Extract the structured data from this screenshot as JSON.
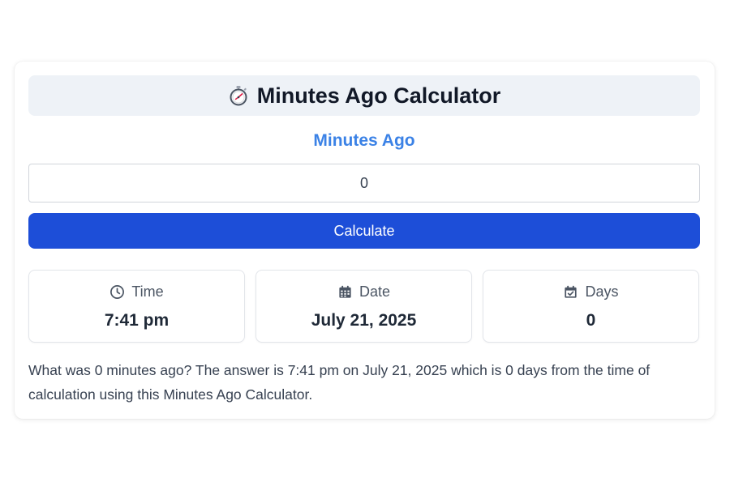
{
  "calculator": {
    "title": "Minutes Ago Calculator",
    "title_icon": "stopwatch-icon",
    "input_label": "Minutes Ago",
    "input_value": "0",
    "button_label": "Calculate"
  },
  "results": {
    "time": {
      "icon": "clock-icon",
      "label": "Time",
      "value": "7:41 pm"
    },
    "date": {
      "icon": "calendar-icon",
      "label": "Date",
      "value": "July 21, 2025"
    },
    "days": {
      "icon": "calendar-check-icon",
      "label": "Days",
      "value": "0"
    }
  },
  "description": "What was 0 minutes ago? The answer is 7:41 pm on July 21, 2025 which is 0 days from the time of calculation using this Minutes Ago Calculator.",
  "colors": {
    "accent_blue": "#3b82e6",
    "button_blue": "#1d4ed8",
    "title_bg": "#eef2f7"
  }
}
